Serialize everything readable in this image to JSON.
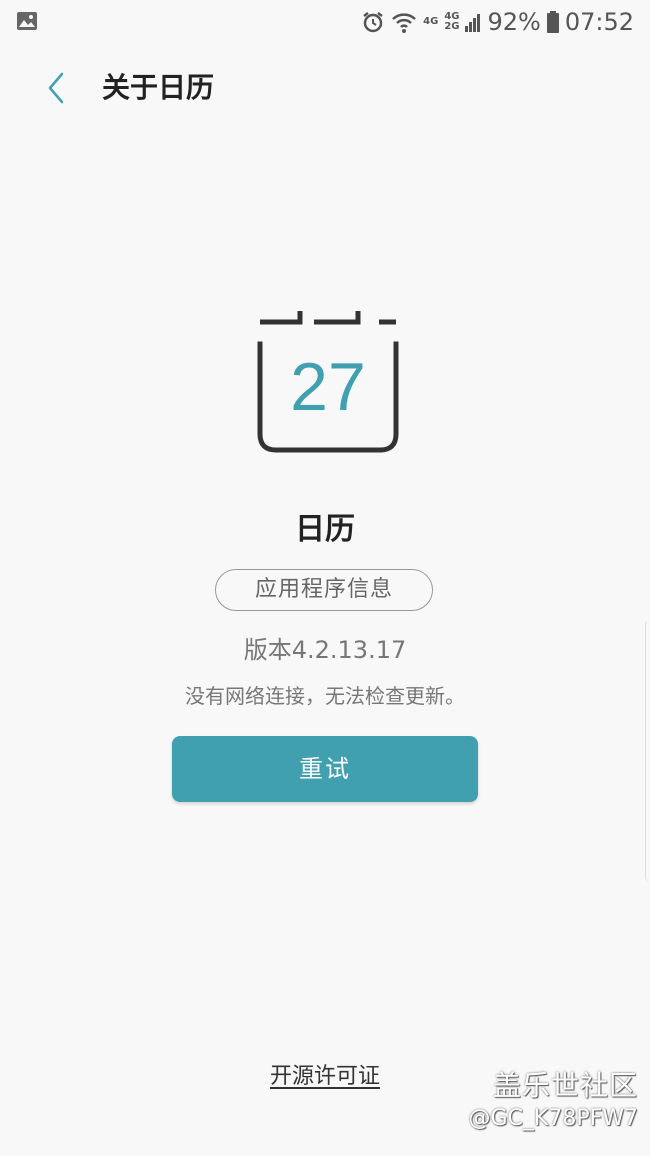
{
  "status_bar": {
    "network_top": "4G",
    "network_second_top": "4G",
    "network_second_bottom": "2G",
    "battery": "92%",
    "time": "07:52"
  },
  "app_bar": {
    "title": "关于日历"
  },
  "app_icon": {
    "day": "27",
    "accent": "#41a0b0"
  },
  "app_info": {
    "name": "日历",
    "info_button_label": "应用程序信息",
    "version": "版本4.2.13.17",
    "message": "没有网络连接，无法检查更新。",
    "retry_label": "重试"
  },
  "footer": {
    "license_label": "开源许可证"
  },
  "watermark": {
    "title": "盖乐世社区",
    "user": "@GC_K78PFW7"
  },
  "colors": {
    "accent": "#41a0b0",
    "background": "#f8f8f8"
  }
}
